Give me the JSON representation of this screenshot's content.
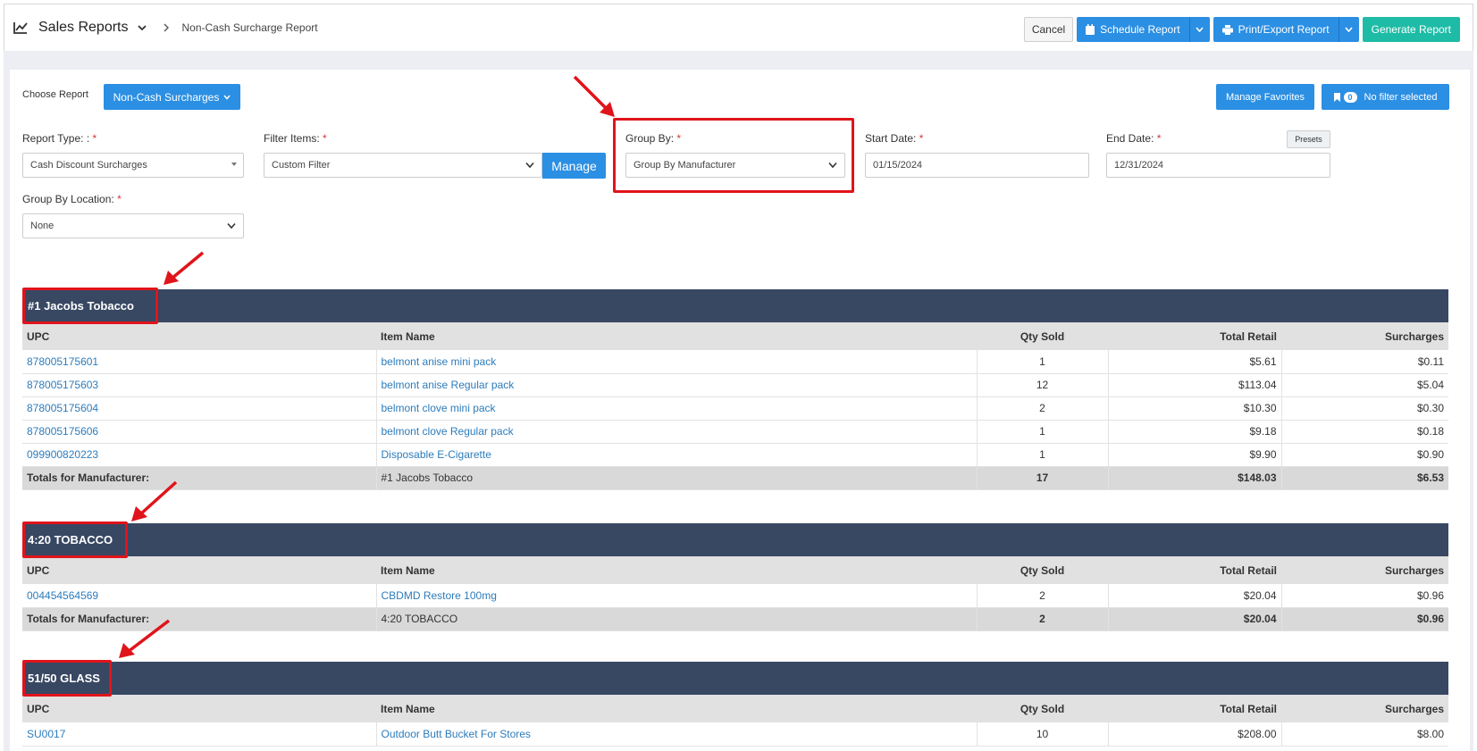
{
  "header": {
    "title": "Sales Reports",
    "breadcrumb": "Non-Cash Surcharge Report",
    "cancel": "Cancel",
    "schedule": "Schedule Report",
    "print_export": "Print/Export Report",
    "generate": "Generate Report"
  },
  "choose": {
    "label": "Choose Report",
    "button": "Non-Cash Surcharges",
    "manage_favorites": "Manage Favorites",
    "filter_count": "0",
    "filter_text": "No filter selected"
  },
  "form": {
    "report_type_label": "Report Type: :",
    "report_type_value": "Cash Discount Surcharges",
    "filter_items_label": "Filter Items:",
    "filter_items_value": "Custom Filter",
    "manage": "Manage",
    "group_by_label": "Group By:",
    "group_by_value": "Group By Manufacturer",
    "start_date_label": "Start Date:",
    "start_date_value": "01/15/2024",
    "end_date_label": "End Date:",
    "end_date_value": "12/31/2024",
    "presets": "Presets",
    "group_loc_label": "Group By Location:",
    "group_loc_value": "None",
    "required_mark": "*"
  },
  "columns": [
    "UPC",
    "Item Name",
    "Qty Sold",
    "Total Retail",
    "Surcharges"
  ],
  "groups": [
    {
      "name": "#1 Jacobs Tobacco",
      "rows": [
        [
          "878005175601",
          "belmont anise mini pack",
          "1",
          "$5.61",
          "$0.11"
        ],
        [
          "878005175603",
          "belmont anise Regular pack",
          "12",
          "$113.04",
          "$5.04"
        ],
        [
          "878005175604",
          "belmont clove mini pack",
          "2",
          "$10.30",
          "$0.30"
        ],
        [
          "878005175606",
          "belmont clove Regular pack",
          "1",
          "$9.18",
          "$0.18"
        ],
        [
          "099900820223",
          "Disposable E-Cigarette",
          "1",
          "$9.90",
          "$0.90"
        ]
      ],
      "totals": [
        "Totals for Manufacturer:",
        "#1 Jacobs Tobacco",
        "17",
        "$148.03",
        "$6.53"
      ]
    },
    {
      "name": "4:20 TOBACCO",
      "rows": [
        [
          "004454564569",
          "CBDMD Restore 100mg",
          "2",
          "$20.04",
          "$0.96"
        ]
      ],
      "totals": [
        "Totals for Manufacturer:",
        "4:20 TOBACCO",
        "2",
        "$20.04",
        "$0.96"
      ]
    },
    {
      "name": "51/50 GLASS",
      "rows": [
        [
          "SU0017",
          "Outdoor Butt Bucket For Stores",
          "10",
          "$208.00",
          "$8.00"
        ]
      ]
    }
  ],
  "icons": {
    "chart": "line-chart-icon",
    "calendar": "calendar-icon",
    "printer": "printer-icon",
    "bookmark": "bookmark-icon"
  },
  "colors": {
    "primary": "#2b8fe3",
    "success": "#1ebca6",
    "group_header": "#384762",
    "annotation": "#e0141b",
    "link": "#2d7cbb"
  }
}
